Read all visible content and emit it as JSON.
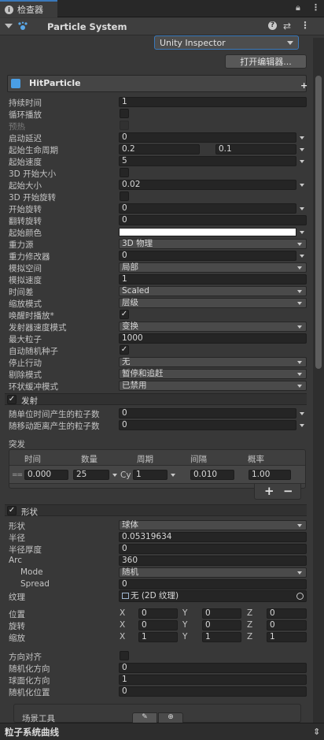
{
  "tab": {
    "title": "检查器"
  },
  "component": {
    "title": "Particle System"
  },
  "preset_dropdown": {
    "value": "Unity Inspector"
  },
  "open_editor_button": {
    "label": "打开编辑器..."
  },
  "module": {
    "title": "HitParticle"
  },
  "main": {
    "duration": {
      "label": "持续时间",
      "value": "1"
    },
    "looping": {
      "label": "循环播放"
    },
    "prewarm": {
      "label": "预热"
    },
    "start_delay": {
      "label": "启动延迟",
      "value": "0"
    },
    "start_lifetime": {
      "label": "起始生命周期",
      "min": "0.2",
      "max": "0.1"
    },
    "start_speed": {
      "label": "起始速度",
      "value": "5"
    },
    "start_size_3d": {
      "label": "3D 开始大小"
    },
    "start_size": {
      "label": "起始大小",
      "value": "0.02"
    },
    "start_rotation_3d": {
      "label": "3D 开始旋转"
    },
    "start_rotation": {
      "label": "开始旋转",
      "value": "0"
    },
    "flip_rotation": {
      "label": "翻转旋转",
      "value": "0"
    },
    "start_color": {
      "label": "起始颜色",
      "color": "#ffffff"
    },
    "gravity_source": {
      "label": "重力源",
      "value": "3D 物理"
    },
    "gravity_modifier": {
      "label": "重力修改器",
      "value": "0"
    },
    "simulation_space": {
      "label": "模拟空间",
      "value": "局部"
    },
    "simulation_speed": {
      "label": "模拟速度",
      "value": "1"
    },
    "delta_time": {
      "label": "时间差",
      "value": "Scaled"
    },
    "scaling_mode": {
      "label": "缩放模式",
      "value": "层级"
    },
    "play_on_awake": {
      "label": "唤醒时播放*"
    },
    "emitter_velocity": {
      "label": "发射器速度模式",
      "value": "变换"
    },
    "max_particles": {
      "label": "最大粒子",
      "value": "1000"
    },
    "auto_random_seed": {
      "label": "自动随机种子"
    },
    "stop_action": {
      "label": "停止行动",
      "value": "无"
    },
    "culling_mode": {
      "label": "剔除模式",
      "value": "暂停和追赶"
    },
    "ring_buffer": {
      "label": "环状缓冲模式",
      "value": "已禁用"
    }
  },
  "emission": {
    "title": "发射",
    "rate_over_time": {
      "label": "随单位时间产生的粒子数",
      "value": "0"
    },
    "rate_over_distance": {
      "label": "随移动距离产生的粒子数",
      "value": "0"
    },
    "bursts": {
      "label": "突发",
      "headers": [
        "时间",
        "数量",
        "周期",
        "间隔",
        "概率"
      ],
      "row": {
        "time": "0.000",
        "count": "25",
        "cycles_prefix": "Cy",
        "cycles": "1",
        "interval": "0.010",
        "probability": "1.00"
      },
      "add": "+",
      "remove": "−"
    }
  },
  "shape": {
    "title": "形状",
    "shape": {
      "label": "形状",
      "value": "球体"
    },
    "radius": {
      "label": "半径",
      "value": "0.05319634"
    },
    "radius_thickness": {
      "label": "半径厚度",
      "value": "0"
    },
    "arc": {
      "label": "Arc",
      "value": "360"
    },
    "mode": {
      "label": "Mode",
      "value": "随机"
    },
    "spread": {
      "label": "Spread",
      "value": "0"
    },
    "texture": {
      "label": "纹理",
      "value": "无 (2D 纹理)"
    },
    "position": {
      "label": "位置",
      "x": "0",
      "y": "0",
      "z": "0"
    },
    "rotation": {
      "label": "旋转",
      "x": "0",
      "y": "0",
      "z": "0"
    },
    "scale": {
      "label": "缩放",
      "x": "1",
      "y": "1",
      "z": "1"
    },
    "align_to_direction": {
      "label": "方向对齐"
    },
    "randomize_direction": {
      "label": "随机化方向",
      "value": "0"
    },
    "spherize_direction": {
      "label": "球面化方向",
      "value": "1"
    },
    "randomize_position": {
      "label": "随机化位置",
      "value": "0"
    },
    "scene_tools": {
      "label": "场景工具"
    },
    "axis_x": "X",
    "axis_y": "Y",
    "axis_z": "Z"
  },
  "curves_bar": {
    "title": "粒子系统曲线"
  }
}
